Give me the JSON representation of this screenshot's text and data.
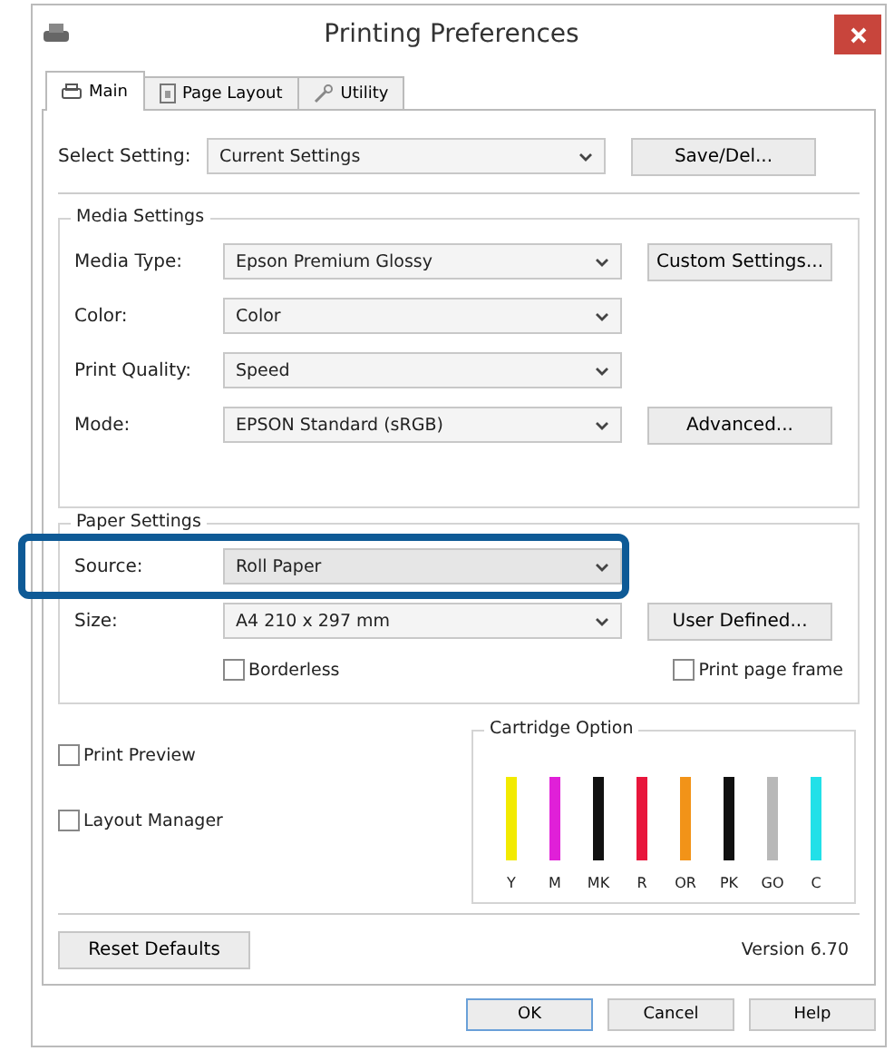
{
  "window": {
    "title": "Printing Preferences"
  },
  "tabs": [
    {
      "label": "Main",
      "kind": "printer",
      "selected": true
    },
    {
      "label": "Page Layout",
      "kind": "page",
      "selected": false
    },
    {
      "label": "Utility",
      "kind": "wrench",
      "selected": false
    }
  ],
  "select_setting": {
    "label": "Select Setting:",
    "value": "Current Settings",
    "button": "Save/Del..."
  },
  "media_settings": {
    "title": "Media Settings",
    "rows": [
      {
        "label": "Media Type:",
        "value": "Epson Premium Glossy",
        "button": "Custom Settings..."
      },
      {
        "label": "Color:",
        "value": "Color"
      },
      {
        "label": "Print Quality:",
        "value": "Speed"
      },
      {
        "label": "Mode:",
        "value": "EPSON Standard (sRGB)",
        "button": "Advanced..."
      }
    ]
  },
  "paper_settings": {
    "title": "Paper Settings",
    "rows": [
      {
        "label": "Source:",
        "value": "Roll Paper",
        "highlighted": true
      },
      {
        "label": "Size:",
        "value": "A4 210 x 297 mm",
        "button": "User Defined...",
        "highlighted": false
      }
    ],
    "borderless": {
      "label": "Borderless",
      "checked": false
    },
    "print_page_frame": {
      "label": "Print page frame",
      "checked": false
    }
  },
  "options": [
    {
      "label": "Print Preview",
      "checked": false
    },
    {
      "label": "Layout Manager",
      "checked": false
    }
  ],
  "cartridge_option": {
    "title": "Cartridge Option",
    "inks": [
      {
        "label": "Y",
        "color": "#f2ea00"
      },
      {
        "label": "M",
        "color": "#e020d8"
      },
      {
        "label": "MK",
        "color": "#111111"
      },
      {
        "label": "R",
        "color": "#e8163c"
      },
      {
        "label": "OR",
        "color": "#f29318"
      },
      {
        "label": "PK",
        "color": "#111111"
      },
      {
        "label": "GO",
        "color": "#b8b8b8"
      },
      {
        "label": "C",
        "color": "#22e0e8"
      }
    ]
  },
  "reset_button": "Reset Defaults",
  "version": "Version 6.70",
  "buttons": [
    {
      "label": "OK",
      "default": true
    },
    {
      "label": "Cancel",
      "default": false
    },
    {
      "label": "Help",
      "default": false
    }
  ]
}
